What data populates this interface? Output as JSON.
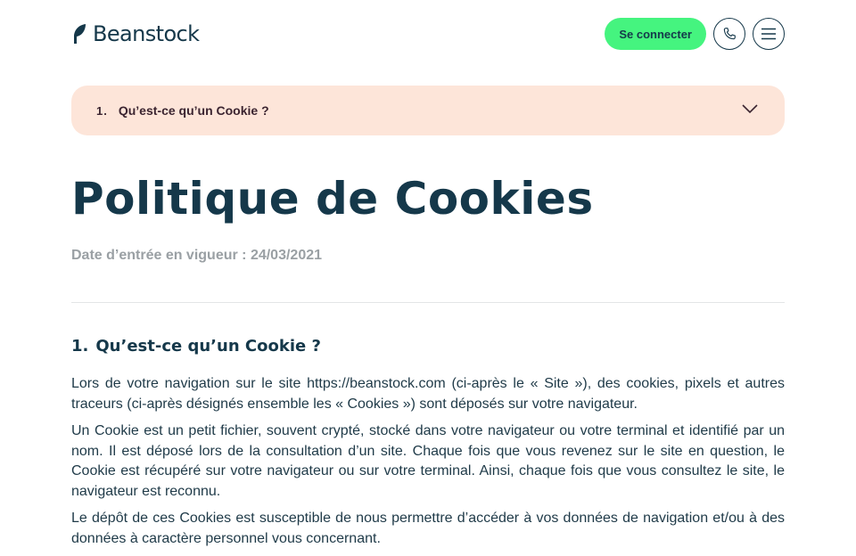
{
  "header": {
    "logo_text": "Beanstock",
    "connect_label": "Se connecter",
    "phone_icon": "phone-icon",
    "menu_icon": "hamburger-menu-icon",
    "accent_color": "#45f47f"
  },
  "accordion": {
    "number": "1.",
    "label": "Qu’est-ce qu’un Cookie ?",
    "background": "#fde5d9"
  },
  "page": {
    "title": "Politique de Cookies",
    "effective_date": "Date d’entrée en vigueur : 24/03/2021"
  },
  "section": {
    "number": "1.",
    "title": "Qu’est-ce qu’un Cookie ?",
    "paragraphs": [
      "Lors de votre navigation sur le site https://beanstock.com (ci-après le « Site »), des cookies, pixels et autres traceurs (ci-après désignés ensemble les « Cookies ») sont déposés sur votre navigateur.",
      "Un Cookie est un petit fichier, souvent crypté, stocké dans votre navigateur ou votre terminal et identifié par un nom. Il est déposé lors de la consultation d’un site. Chaque fois que vous revenez sur le site en question, le Cookie est récupéré sur votre navigateur ou sur votre terminal. Ainsi, chaque fois que vous consultez le site, le navigateur est reconnu.",
      "Le dépôt de ces Cookies est susceptible de nous permettre d’accéder à vos données de navigation et/ou à des données à caractère personnel vous concernant."
    ]
  }
}
